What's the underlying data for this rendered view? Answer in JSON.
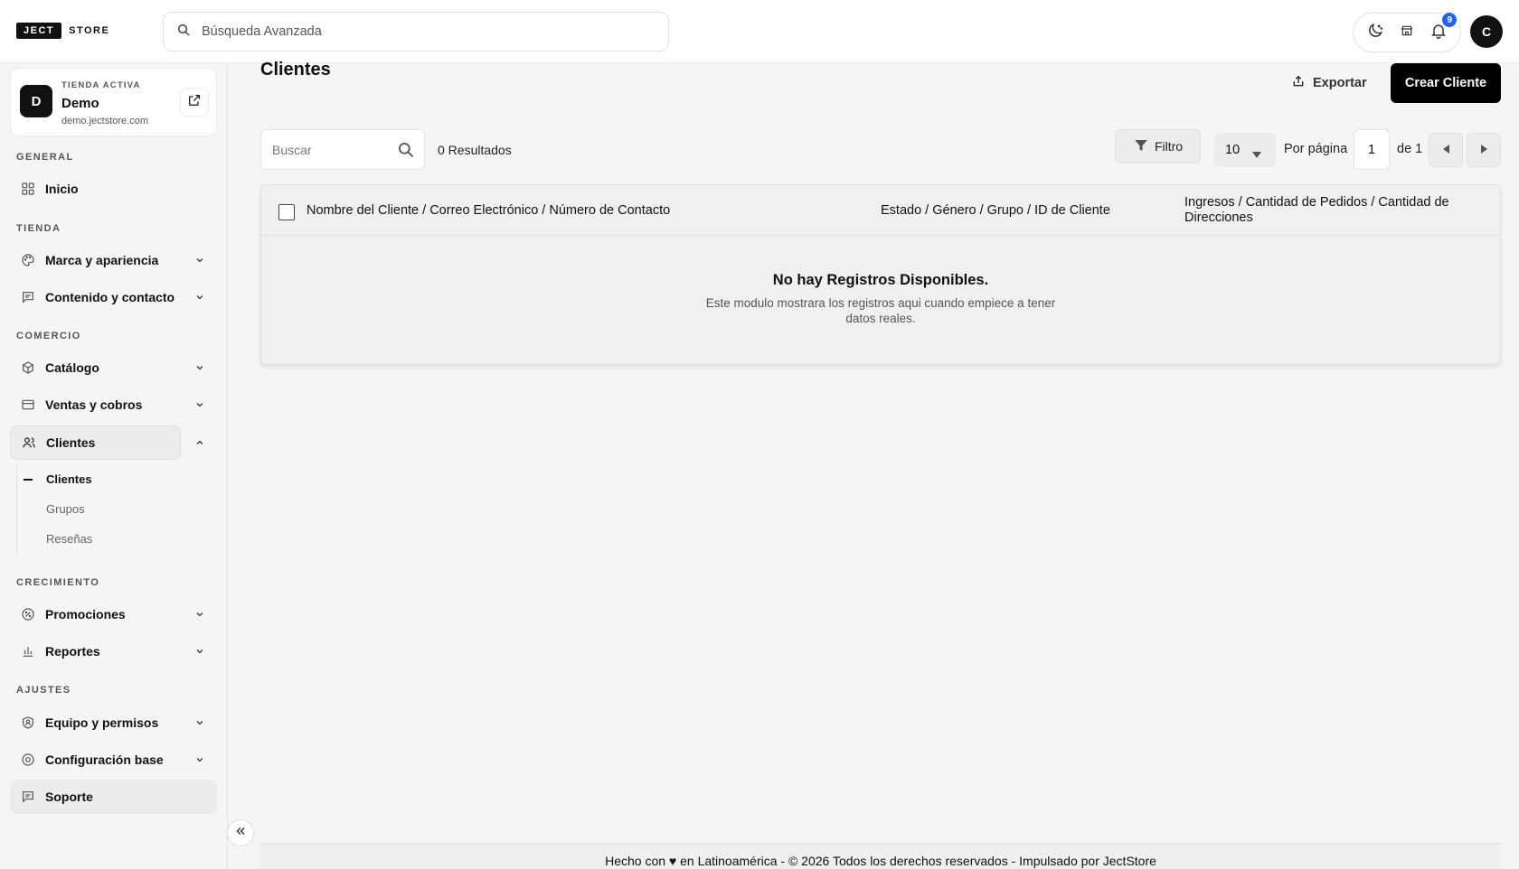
{
  "brand": {
    "logo_box": "JECT",
    "logo_text": "STORE"
  },
  "topbar": {
    "search_placeholder": "Búsqueda Avanzada",
    "notifications_count": "9",
    "avatar_initial": "C"
  },
  "store": {
    "label": "TIENDA ACTIVA",
    "initial": "D",
    "name": "Demo",
    "url": "demo.jectstore.com"
  },
  "sidebar": {
    "sections": {
      "general": "GENERAL",
      "tienda": "TIENDA",
      "comercio": "COMERCIO",
      "crecimiento": "CRECIMIENTO",
      "ajustes": "AJUSTES"
    },
    "items": {
      "inicio": "Inicio",
      "marca": "Marca y apariencia",
      "contenido": "Contenido y contacto",
      "catalogo": "Catálogo",
      "ventas": "Ventas y cobros",
      "clientes": "Clientes",
      "promociones": "Promociones",
      "reportes": "Reportes",
      "equipo": "Equipo y permisos",
      "config": "Configuración base",
      "soporte": "Soporte"
    },
    "sub_clientes": [
      "Clientes",
      "Grupos",
      "Reseñas"
    ]
  },
  "main": {
    "title": "Clientes",
    "export_label": "Exportar",
    "create_label": "Crear Cliente",
    "search_placeholder": "Buscar",
    "results": "0 Resultados",
    "filter_label": "Filtro",
    "per_page_value": "10",
    "per_page_label": "Por página",
    "page_current": "1",
    "page_of": "de 1"
  },
  "table": {
    "columns": [
      "Nombre del Cliente / Correo Electrónico / Número de Contacto",
      "Estado / Género / Grupo / ID de Cliente",
      "Ingresos / Cantidad de Pedidos / Cantidad de Direcciones"
    ],
    "empty_title": "No hay Registros Disponibles.",
    "empty_subtitle": "Este modulo mostrara los registros aqui cuando empiece a tener datos reales."
  },
  "footer": {
    "text": "Hecho con ♥ en Latinoamérica - © 2026 Todos los derechos reservados - Impulsado por JectStore"
  }
}
